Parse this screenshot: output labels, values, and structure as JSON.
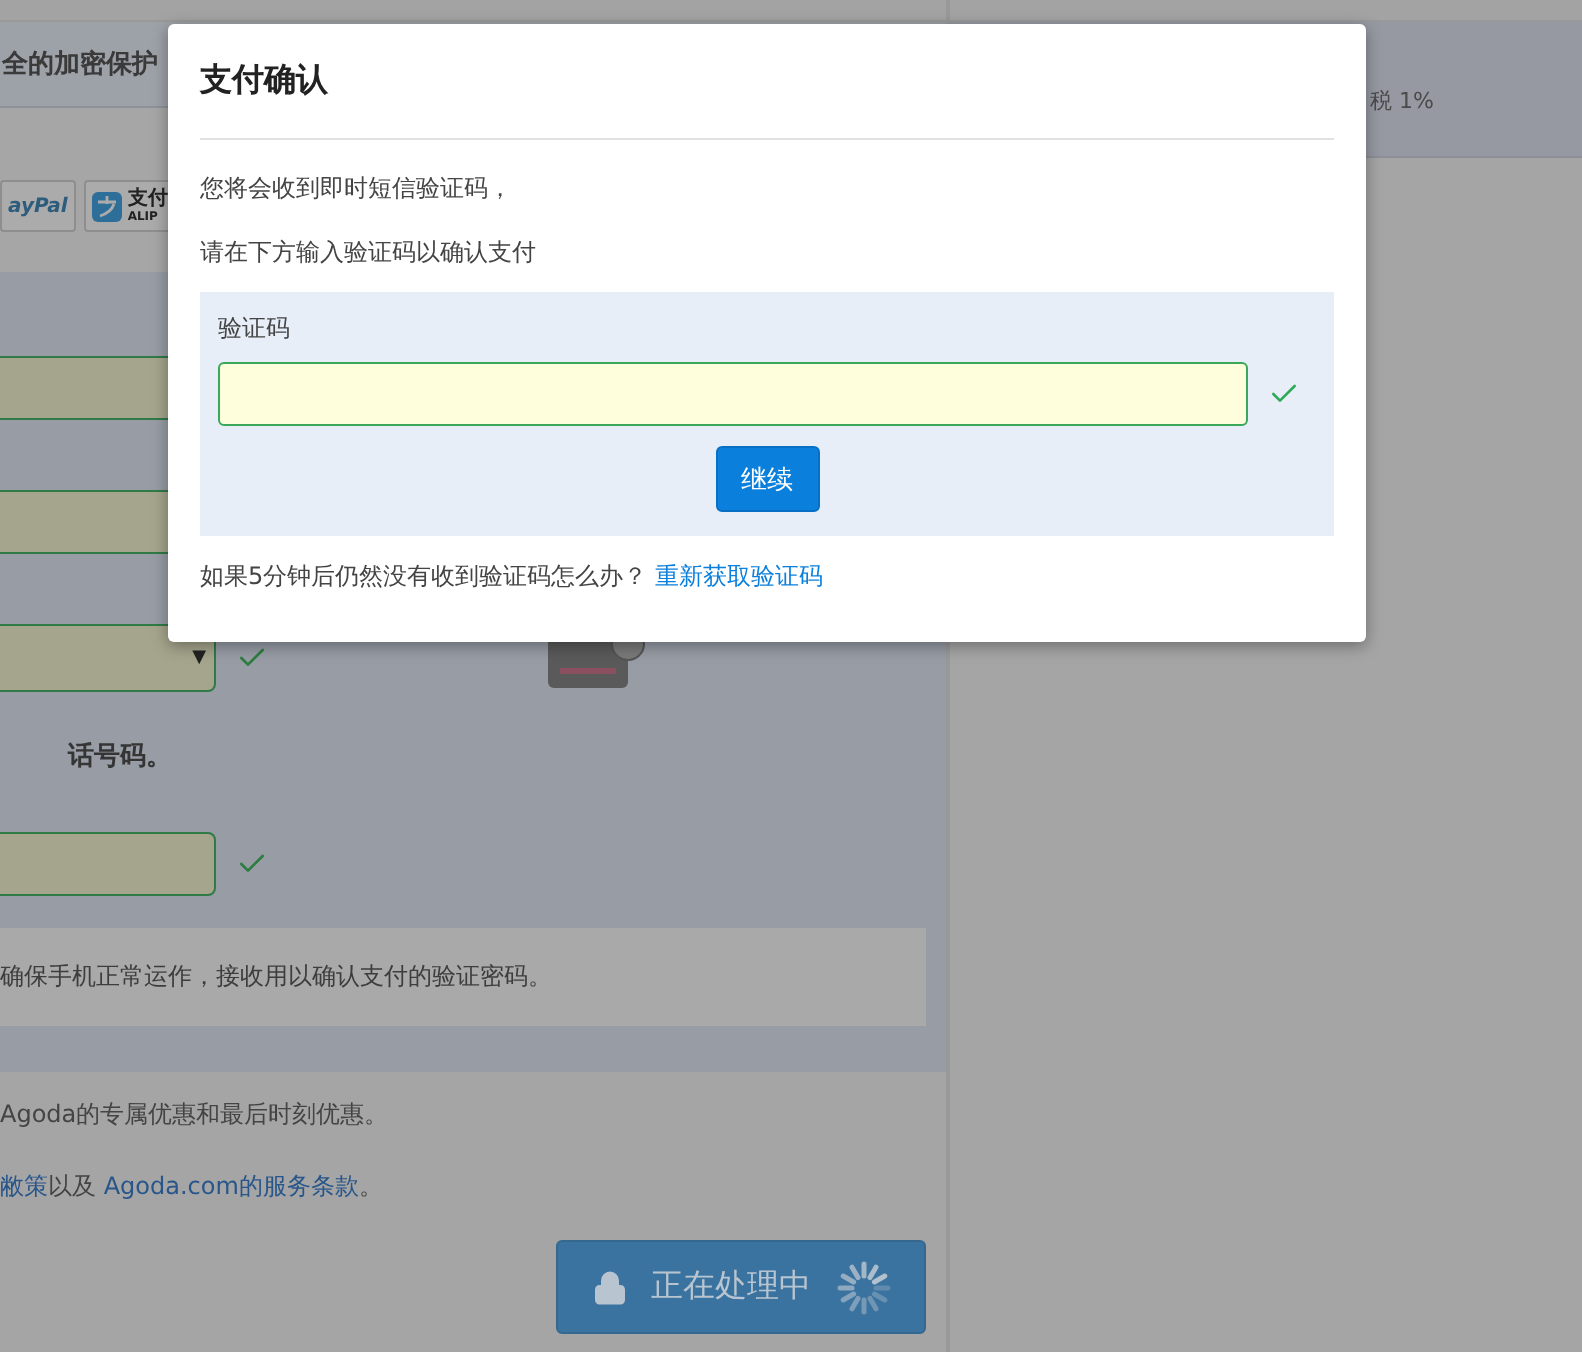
{
  "background_page": {
    "header_text": "全的加密保护",
    "payment_logos": [
      {
        "kind": "paypal",
        "label": "ayPal"
      },
      {
        "kind": "alipay",
        "label": "支付",
        "sublabel": "ALIP"
      }
    ],
    "form_rows": [
      {
        "kind": "input"
      },
      {
        "kind": "input"
      },
      {
        "kind": "select",
        "valid": true,
        "caret": "▼"
      },
      {
        "kind": "note",
        "text": "话号码。"
      },
      {
        "kind": "input",
        "valid": true
      }
    ],
    "info_text": "确保手机正常运作，接收用以确认支付的验证密码。",
    "offers_text": "Agoda的专属优惠和最后时刻优惠。",
    "terms": [
      {
        "kind": "link",
        "text": "敝策"
      },
      {
        "kind": "text",
        "text": "以及 "
      },
      {
        "kind": "link",
        "text": "Agoda.com的服务条款"
      },
      {
        "kind": "text",
        "text": "。"
      }
    ],
    "submit_button": {
      "label": "正在处理中",
      "disabled": true
    },
    "summary_text": "税 1%"
  },
  "dialog": {
    "title": "支付确认",
    "lines": [
      "您将会收到即时短信验证码，",
      "请在下方输入验证码以确认支付"
    ],
    "code_field": {
      "label": "验证码",
      "valid": true
    },
    "continue_button": "继续",
    "help_text": "如果5分钟后仍然没有收到验证码怎么办？",
    "resend_link": "重新获取验证码"
  }
}
